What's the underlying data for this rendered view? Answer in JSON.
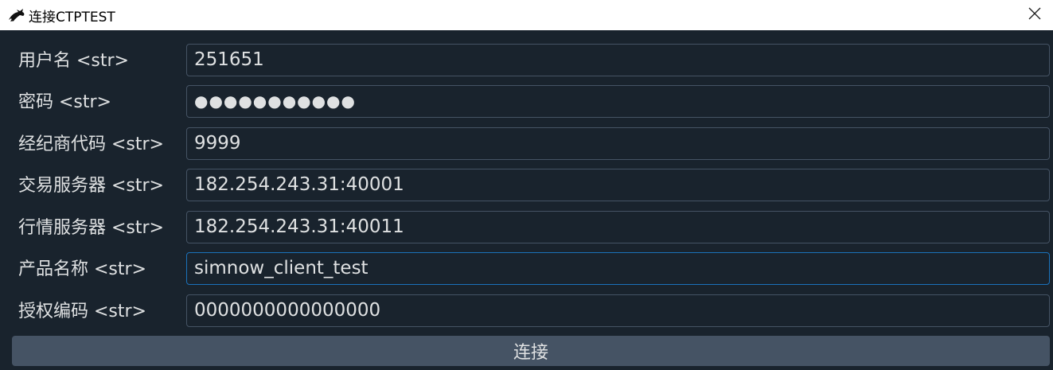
{
  "window": {
    "title": "连接CTPTEST",
    "icon": "app-logo-icon",
    "close_icon": "close-icon"
  },
  "form": {
    "fields": [
      {
        "label": "用户名 <str>",
        "value": "251651",
        "type": "text"
      },
      {
        "label": "密码 <str>",
        "value": "●●●●●●●●●●●",
        "type": "password"
      },
      {
        "label": "经纪商代码 <str>",
        "value": "9999",
        "type": "text"
      },
      {
        "label": "交易服务器 <str>",
        "value": "182.254.243.31:40001",
        "type": "text"
      },
      {
        "label": "行情服务器 <str>",
        "value": "182.254.243.31:40011",
        "type": "text"
      },
      {
        "label": "产品名称 <str>",
        "value": "simnow_client_test",
        "type": "text",
        "focused": true
      },
      {
        "label": "授权编码 <str>",
        "value": "0000000000000000",
        "type": "text"
      }
    ]
  },
  "connect_button": {
    "label": "连接"
  },
  "colors": {
    "background": "#19232d",
    "field_border": "#455364",
    "focus_border": "#1a72bb",
    "text": "#dfe1e2",
    "button": "#455364"
  }
}
